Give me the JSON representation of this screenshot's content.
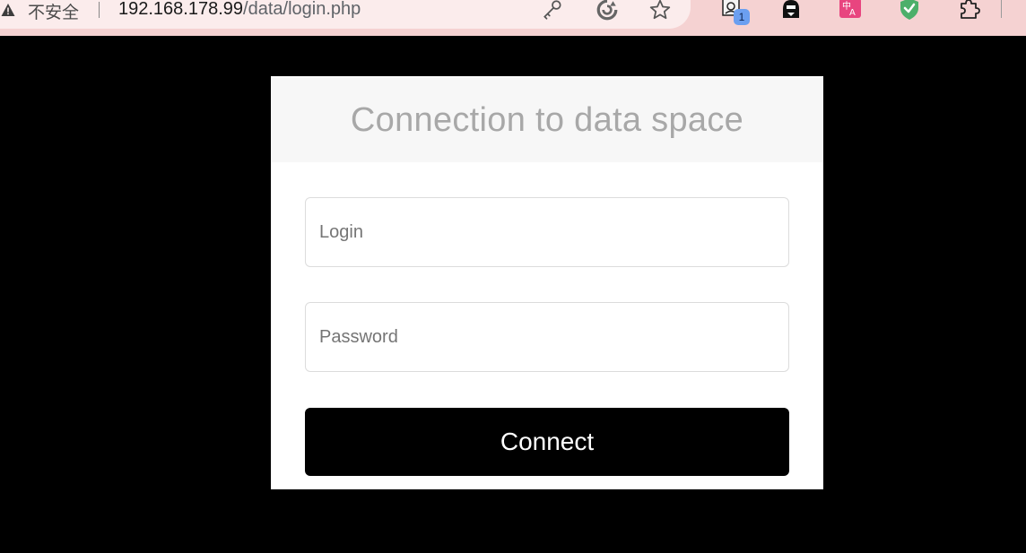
{
  "browser": {
    "security_label": "不安全",
    "url_host": "192.168.178.99",
    "url_path": "/data/login.php",
    "icons": [
      "warning-icon",
      "key-icon",
      "edge-refresh-icon",
      "star-icon"
    ],
    "extensions": [
      {
        "name": "extension-comic-icon",
        "badge": "1"
      },
      {
        "name": "extension-person-icon"
      },
      {
        "name": "extension-translate-icon"
      },
      {
        "name": "extension-shield-icon"
      },
      {
        "name": "extensions-puzzle-icon"
      }
    ],
    "colors": {
      "bar": "#f5d2d2",
      "omnibox": "#fbecec"
    }
  },
  "login": {
    "title": "Connection to data space",
    "login_placeholder": "Login",
    "password_placeholder": "Password",
    "submit_label": "Connect"
  },
  "colors": {
    "page_bg": "#000000",
    "card_bg": "#ffffff",
    "header_bg": "#f7f7f7",
    "title_color": "#a8a8a8",
    "button_bg": "#000000",
    "button_text": "#ffffff"
  }
}
